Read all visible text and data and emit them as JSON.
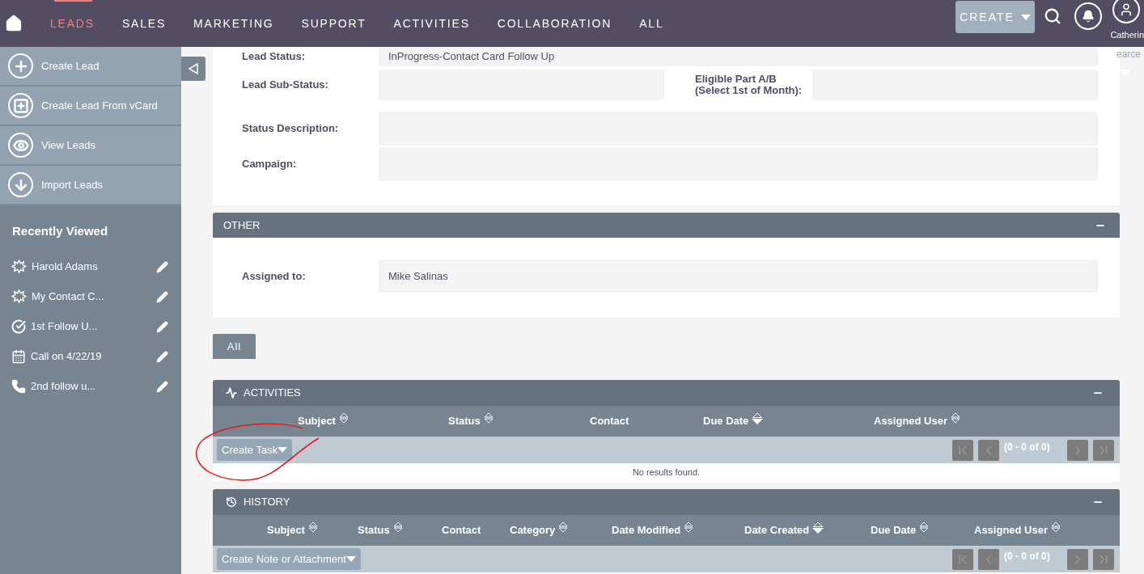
{
  "nav": {
    "items": [
      {
        "label": "LEADS",
        "selected": true
      },
      {
        "label": "SALES",
        "selected": false
      },
      {
        "label": "MARKETING",
        "selected": false
      },
      {
        "label": "SUPPORT",
        "selected": false
      },
      {
        "label": "ACTIVITIES",
        "selected": false
      },
      {
        "label": "COLLABORATION",
        "selected": false
      },
      {
        "label": "ALL",
        "selected": false
      }
    ],
    "create_button": "CREATE",
    "user_name": "Catherin",
    "user_name_rest": "earce"
  },
  "sidebar": {
    "actions": [
      {
        "label": "Create Lead",
        "kind": "plus"
      },
      {
        "label": "Create Lead From vCard",
        "kind": "card"
      },
      {
        "label": "View Leads",
        "kind": "eye"
      },
      {
        "label": "Import Leads",
        "kind": "import"
      }
    ],
    "recent_title": "Recently Viewed",
    "recent": [
      {
        "label": "Harold Adams",
        "kind": "lead"
      },
      {
        "label": "My Contact C...",
        "kind": "lead"
      },
      {
        "label": "1st Follow U...",
        "kind": "task"
      },
      {
        "label": "Call on 4/22/19",
        "kind": "meeting"
      },
      {
        "label": "2nd follow u...",
        "kind": "call"
      }
    ]
  },
  "detail": {
    "rows": [
      {
        "fields": [
          {
            "label": [
              "Lead Status:"
            ],
            "value": "InProgress-Contact Card Follow Up"
          }
        ]
      },
      {
        "fields": [
          {
            "label": [
              "Lead Sub-Status:"
            ]
          },
          {
            "label": [
              "Eligible Part A/B",
              "(Select 1st of Month):"
            ]
          }
        ]
      },
      {
        "fields": [
          {
            "label": [
              "Status Description:"
            ]
          }
        ]
      },
      {
        "fields": [
          {
            "label": [
              "Campaign:"
            ]
          }
        ]
      }
    ]
  },
  "other": {
    "title": "OTHER",
    "rows": [
      {
        "label": "Assigned to:",
        "value": "Mike Salinas"
      }
    ]
  },
  "tabs": [
    {
      "label": "All",
      "selected": true
    }
  ],
  "activities": {
    "title": "ACTIVITIES",
    "columns": [
      {
        "label": "Subject",
        "sortable": true,
        "sorted": false
      },
      {
        "label": "Status",
        "sortable": true,
        "sorted": false
      },
      {
        "label": "Contact",
        "sortable": false,
        "sorted": false
      },
      {
        "label": "Due Date",
        "sortable": true,
        "sorted": true
      },
      {
        "label": "Assigned User",
        "sortable": true,
        "sorted": false
      }
    ],
    "action": "Create Task",
    "pagination": "(0 - 0 of 0)",
    "empty": "No results found."
  },
  "history": {
    "title": "HISTORY",
    "columns": [
      {
        "label": "Subject",
        "sortable": true,
        "sorted": false
      },
      {
        "label": "Status",
        "sortable": true,
        "sorted": false
      },
      {
        "label": "Contact",
        "sortable": false,
        "sorted": false
      },
      {
        "label": "Category",
        "sortable": true,
        "sorted": false
      },
      {
        "label": "Date Modified",
        "sortable": true,
        "sorted": false
      },
      {
        "label": "Date Created",
        "sortable": true,
        "sorted": true
      },
      {
        "label": "Due Date",
        "sortable": true,
        "sorted": false
      },
      {
        "label": "Assigned User",
        "sortable": true,
        "sorted": false
      }
    ],
    "action": "Create Note or Attachment",
    "pagination": "(0 - 0 of 0)"
  }
}
